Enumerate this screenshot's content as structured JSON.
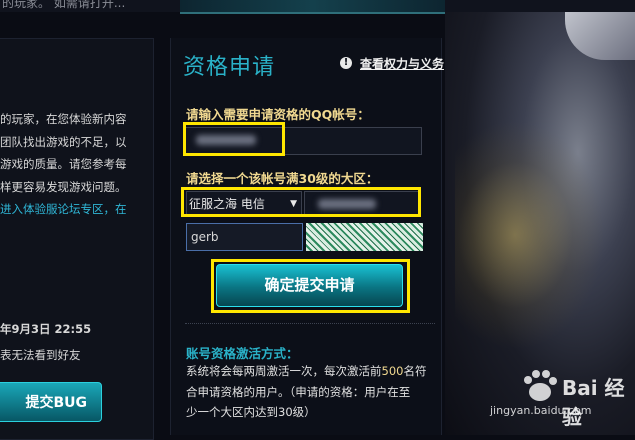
{
  "top": {
    "left_text": "的玩家。 如需请打开..."
  },
  "left_panel": {
    "lines": [
      "的玩家，在您体验新内容",
      "团队找出游戏的不足，以",
      "游戏的质量。请您参考每",
      "样更容易发现游戏问题。"
    ],
    "link_text": "进入体验服论坛专区，在",
    "date_text": "年9月3日 22:55",
    "note_text": "表无法看到好友",
    "submit_bug_label": "提交BUG"
  },
  "form": {
    "title": "资格申请",
    "info_icon": "!",
    "rights_link": "查看权力与义务",
    "qq_label": "请输入需要申请资格的QQ帐号：",
    "region_label": "请选择一个该帐号满30级的大区：",
    "region_selected": "征服之海 电信",
    "captcha_value": "gerb",
    "submit_label": "确定提交申请"
  },
  "activation": {
    "title": "账号资格激活方式：",
    "line1_pre": "系统将会每两周激活一次，每次激活前",
    "line1_num": "500",
    "line1_post": "名符",
    "line2": "合申请资格的用户。（申请的资格：用户在至",
    "line3": "少一个大区内达到30级）"
  },
  "watermark": {
    "brand": "Bai 经验",
    "url": "jingyan.baidu.com"
  },
  "colors": {
    "accent": "#2ab2c8",
    "highlight": "#ffe600",
    "label": "#f0d890"
  }
}
